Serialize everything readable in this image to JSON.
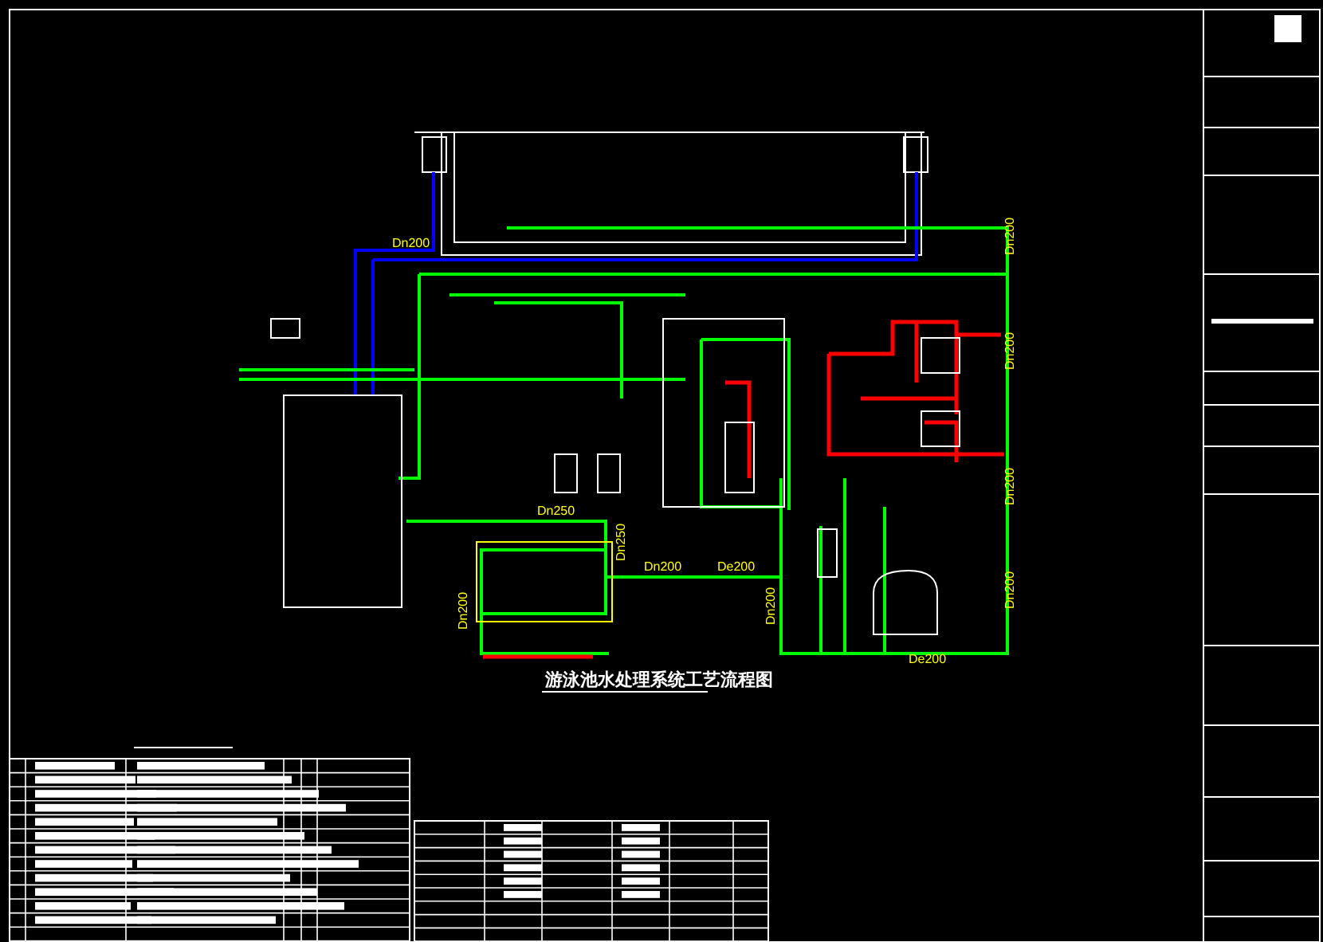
{
  "drawing": {
    "title": "游泳池水处理系统工艺流程图",
    "pipe_labels": [
      {
        "text": "Dn200"
      },
      {
        "text": "Dn250"
      },
      {
        "text": "Dn250"
      },
      {
        "text": "Dn200"
      },
      {
        "text": "De200"
      },
      {
        "text": "Dn200"
      },
      {
        "text": "Dn200"
      },
      {
        "text": "De200"
      },
      {
        "text": "Dn200"
      },
      {
        "text": "Dn200"
      },
      {
        "text": "Dn200"
      },
      {
        "text": "Dn200"
      }
    ]
  }
}
